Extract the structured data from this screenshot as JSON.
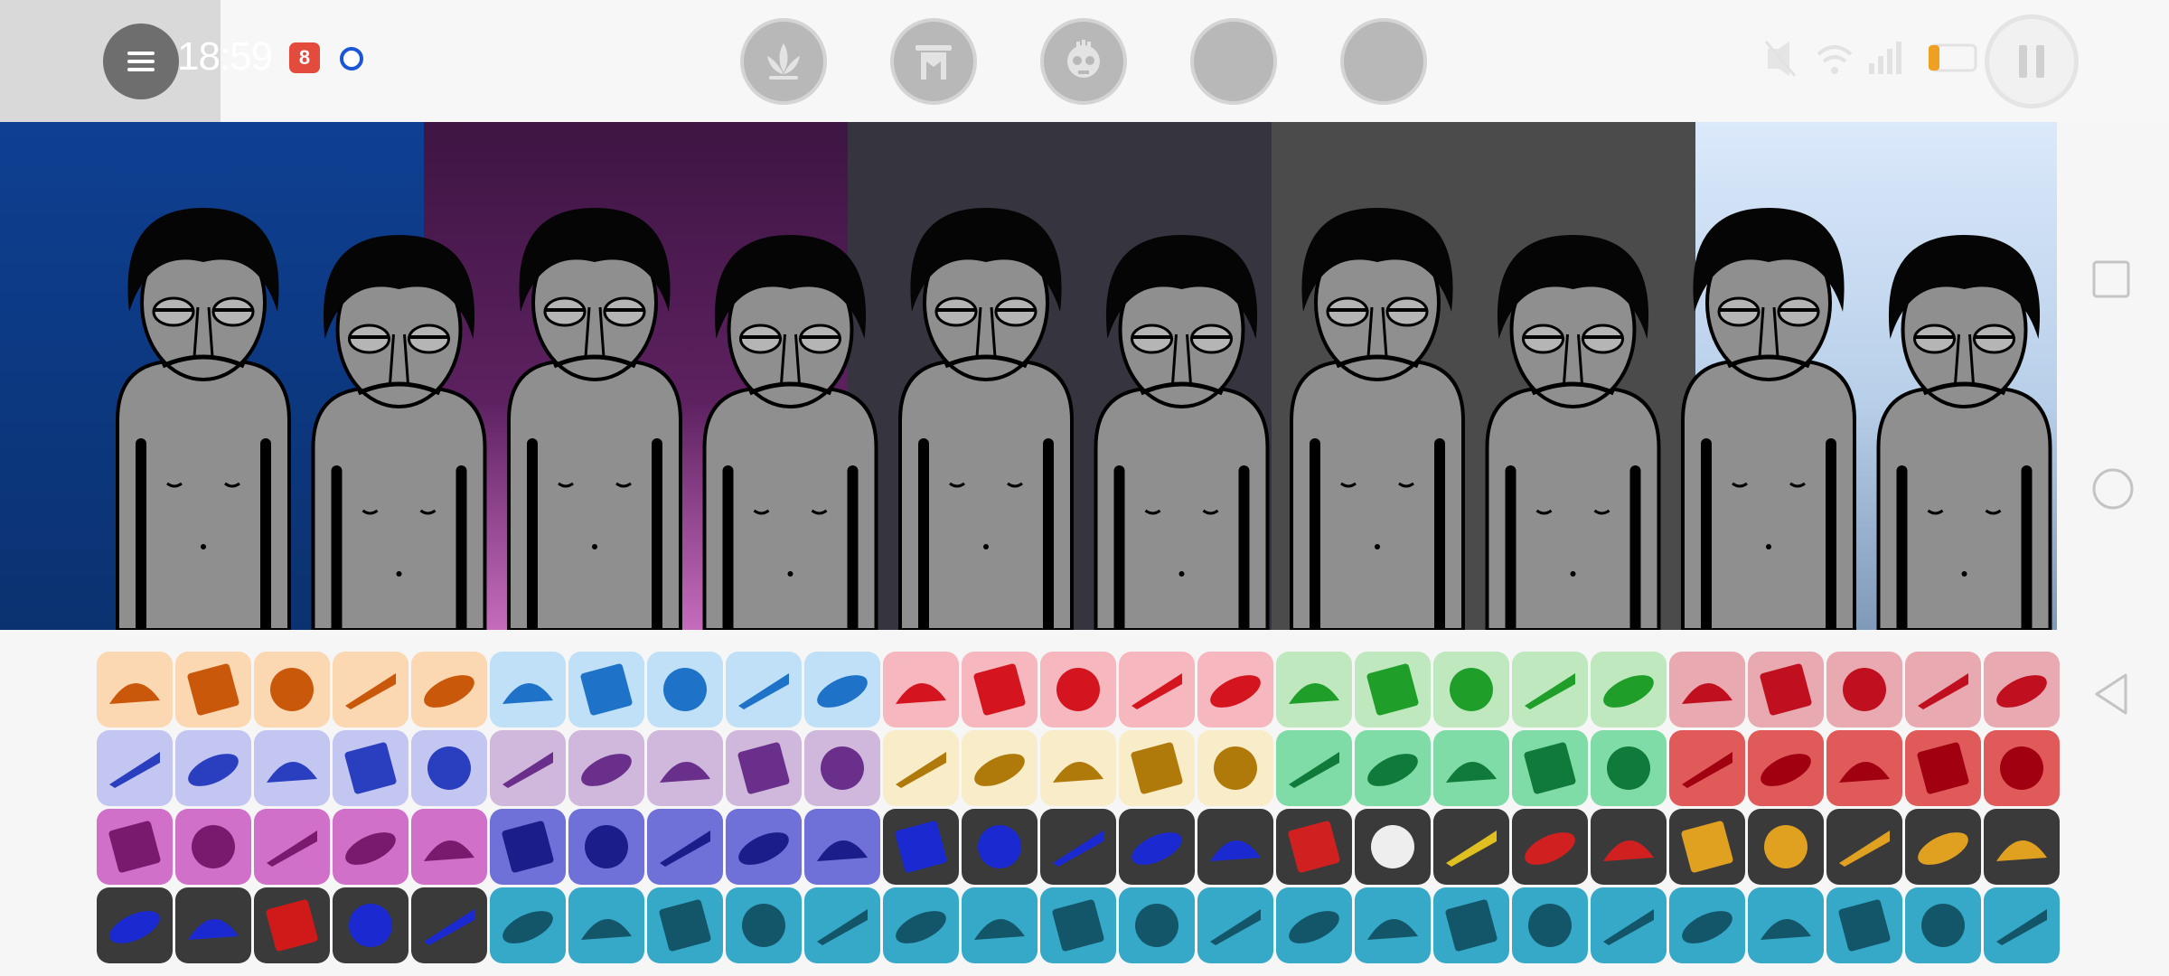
{
  "status_bar": {
    "time": "18:59",
    "notification_badge": "8"
  },
  "colors": {
    "panel_backgrounds": [
      "#0d3a86",
      "#5a1f5a",
      "#35343f",
      "#4a4a4a",
      "#b9d2ef"
    ],
    "category_colors": [
      "#fbd7b2",
      "#bfe0f7",
      "#f6b8be",
      "#bfe8bf",
      "#e8a9b0",
      "#c4c6f2",
      "#cfb8dc",
      "#f8edc8",
      "#7fdca7",
      "#e05a5a",
      "#d170c8",
      "#6f70d8",
      "#3a3a3a",
      "#36a8c8"
    ]
  },
  "top_bar": {
    "mode_buttons": [
      {
        "icon": "lotus-icon"
      },
      {
        "icon": "temple-icon"
      },
      {
        "icon": "skull-icon"
      },
      {
        "icon": "blank-circle-icon"
      },
      {
        "icon": "blank-circle-icon"
      }
    ],
    "status_icons": [
      "mute-icon",
      "wifi-icon",
      "signal-icon",
      "battery-icon"
    ],
    "pause_icon": "pause-icon"
  },
  "stage": {
    "characters": 10,
    "character_icon": "polo-character-icon"
  },
  "nav": [
    "recent-apps-icon",
    "home-icon",
    "back-icon"
  ],
  "palette": {
    "rows": [
      [
        "#fbd7b2",
        "#fbd7b2",
        "#fbd7b2",
        "#fbd7b2",
        "#fbd7b2",
        "#bfe0f7",
        "#bfe0f7",
        "#bfe0f7",
        "#bfe0f7",
        "#bfe0f7",
        "#f6b8be",
        "#f6b8be",
        "#f6b8be",
        "#f6b8be",
        "#f6b8be",
        "#bfe8bf",
        "#bfe8bf",
        "#bfe8bf",
        "#bfe8bf",
        "#bfe8bf",
        "#e8a9b0",
        "#e8a9b0",
        "#e8a9b0",
        "#e8a9b0",
        "#e8a9b0"
      ],
      [
        "#c4c6f2",
        "#c4c6f2",
        "#c4c6f2",
        "#c4c6f2",
        "#c4c6f2",
        "#cfb8dc",
        "#cfb8dc",
        "#cfb8dc",
        "#cfb8dc",
        "#cfb8dc",
        "#f8edc8",
        "#f8edc8",
        "#f8edc8",
        "#f8edc8",
        "#f8edc8",
        "#7fdca7",
        "#7fdca7",
        "#7fdca7",
        "#7fdca7",
        "#7fdca7",
        "#e05a5a",
        "#e05a5a",
        "#e05a5a",
        "#e05a5a",
        "#e05a5a"
      ],
      [
        "#d170c8",
        "#d170c8",
        "#d170c8",
        "#d170c8",
        "#d170c8",
        "#6f70d8",
        "#6f70d8",
        "#6f70d8",
        "#6f70d8",
        "#6f70d8",
        "#3a3a3a",
        "#3a3a3a",
        "#3a3a3a",
        "#3a3a3a",
        "#3a3a3a",
        "#3a3a3a",
        "#3a3a3a",
        "#3a3a3a",
        "#3a3a3a",
        "#3a3a3a",
        "#3a3a3a",
        "#3a3a3a",
        "#3a3a3a",
        "#3a3a3a",
        "#3a3a3a"
      ],
      [
        "#3a3a3a",
        "#3a3a3a",
        "#3a3a3a",
        "#3a3a3a",
        "#3a3a3a",
        "#36a8c8",
        "#36a8c8",
        "#36a8c8",
        "#36a8c8",
        "#36a8c8",
        "#36a8c8",
        "#36a8c8",
        "#36a8c8",
        "#36a8c8",
        "#36a8c8",
        "#36a8c8",
        "#36a8c8",
        "#36a8c8",
        "#36a8c8",
        "#36a8c8",
        "#36a8c8",
        "#36a8c8",
        "#36a8c8",
        "#36a8c8",
        "#36a8c8"
      ]
    ],
    "glyph_colors": [
      [
        "#c9580a",
        "#c9580a",
        "#c9580a",
        "#c9580a",
        "#c9580a",
        "#1e73c9",
        "#1e73c9",
        "#1e73c9",
        "#1e73c9",
        "#1e73c9",
        "#d4141e",
        "#d4141e",
        "#d4141e",
        "#d4141e",
        "#d4141e",
        "#1f9e2a",
        "#1f9e2a",
        "#1f9e2a",
        "#1f9e2a",
        "#1f9e2a",
        "#c01020",
        "#c01020",
        "#c01020",
        "#c01020",
        "#c01020"
      ],
      [
        "#2a3fbf",
        "#2a3fbf",
        "#2a3fbf",
        "#2a3fbf",
        "#2a3fbf",
        "#6a2f8a",
        "#6a2f8a",
        "#6a2f8a",
        "#6a2f8a",
        "#6a2f8a",
        "#b07a0a",
        "#b07a0a",
        "#b07a0a",
        "#b07a0a",
        "#b07a0a",
        "#0f7a3a",
        "#0f7a3a",
        "#0f7a3a",
        "#0f7a3a",
        "#0f7a3a",
        "#a00010",
        "#a00010",
        "#a00010",
        "#a00010",
        "#a00010"
      ],
      [
        "#7a1a6e",
        "#7a1a6e",
        "#7a1a6e",
        "#7a1a6e",
        "#7a1a6e",
        "#1a1d8a",
        "#1a1d8a",
        "#1a1d8a",
        "#1a1d8a",
        "#1a1d8a",
        "#1a2ad0",
        "#1a2ad0",
        "#1a2ad0",
        "#1a2ad0",
        "#1a2ad0",
        "#d02020",
        "#eeeeee",
        "#e0c020",
        "#d02020",
        "#d02020",
        "#e0a020",
        "#e0a020",
        "#e0a020",
        "#e0a020",
        "#e0a020"
      ],
      [
        "#1a2ad0",
        "#1a2ad0",
        "#d01a1a",
        "#1a2ad0",
        "#1a2ad0",
        "#13566a",
        "#13566a",
        "#13566a",
        "#13566a",
        "#13566a",
        "#13566a",
        "#13566a",
        "#13566a",
        "#13566a",
        "#13566a",
        "#13566a",
        "#13566a",
        "#13566a",
        "#13566a",
        "#13566a",
        "#13566a",
        "#13566a",
        "#13566a",
        "#13566a",
        "#13566a"
      ]
    ]
  }
}
